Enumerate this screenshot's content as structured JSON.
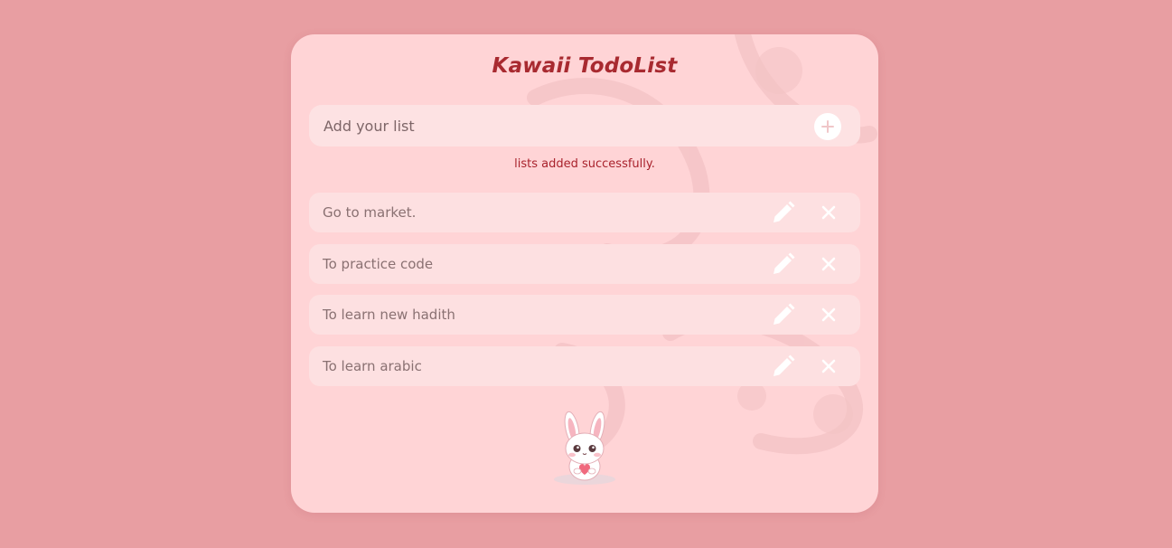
{
  "app": {
    "title": "Kawaii TodoList"
  },
  "input": {
    "placeholder": "Add your list",
    "value": "",
    "add_icon": "plus-icon"
  },
  "status": {
    "message": "lists added successfully."
  },
  "todos": [
    {
      "text": "Go to market.",
      "edit_icon": "pencil-icon",
      "delete_icon": "close-icon"
    },
    {
      "text": "To practice code",
      "edit_icon": "pencil-icon",
      "delete_icon": "close-icon"
    },
    {
      "text": "To learn new hadith",
      "edit_icon": "pencil-icon",
      "delete_icon": "close-icon"
    },
    {
      "text": "To learn arabic",
      "edit_icon": "pencil-icon",
      "delete_icon": "close-icon"
    }
  ],
  "mascot": {
    "icon": "bunny-mascot-icon"
  },
  "colors": {
    "page_background": "#e89ea2",
    "card_background": "#ffd4d6",
    "title": "#a82a30",
    "status_message": "#a8222c",
    "row_background": "#fde0e1"
  }
}
